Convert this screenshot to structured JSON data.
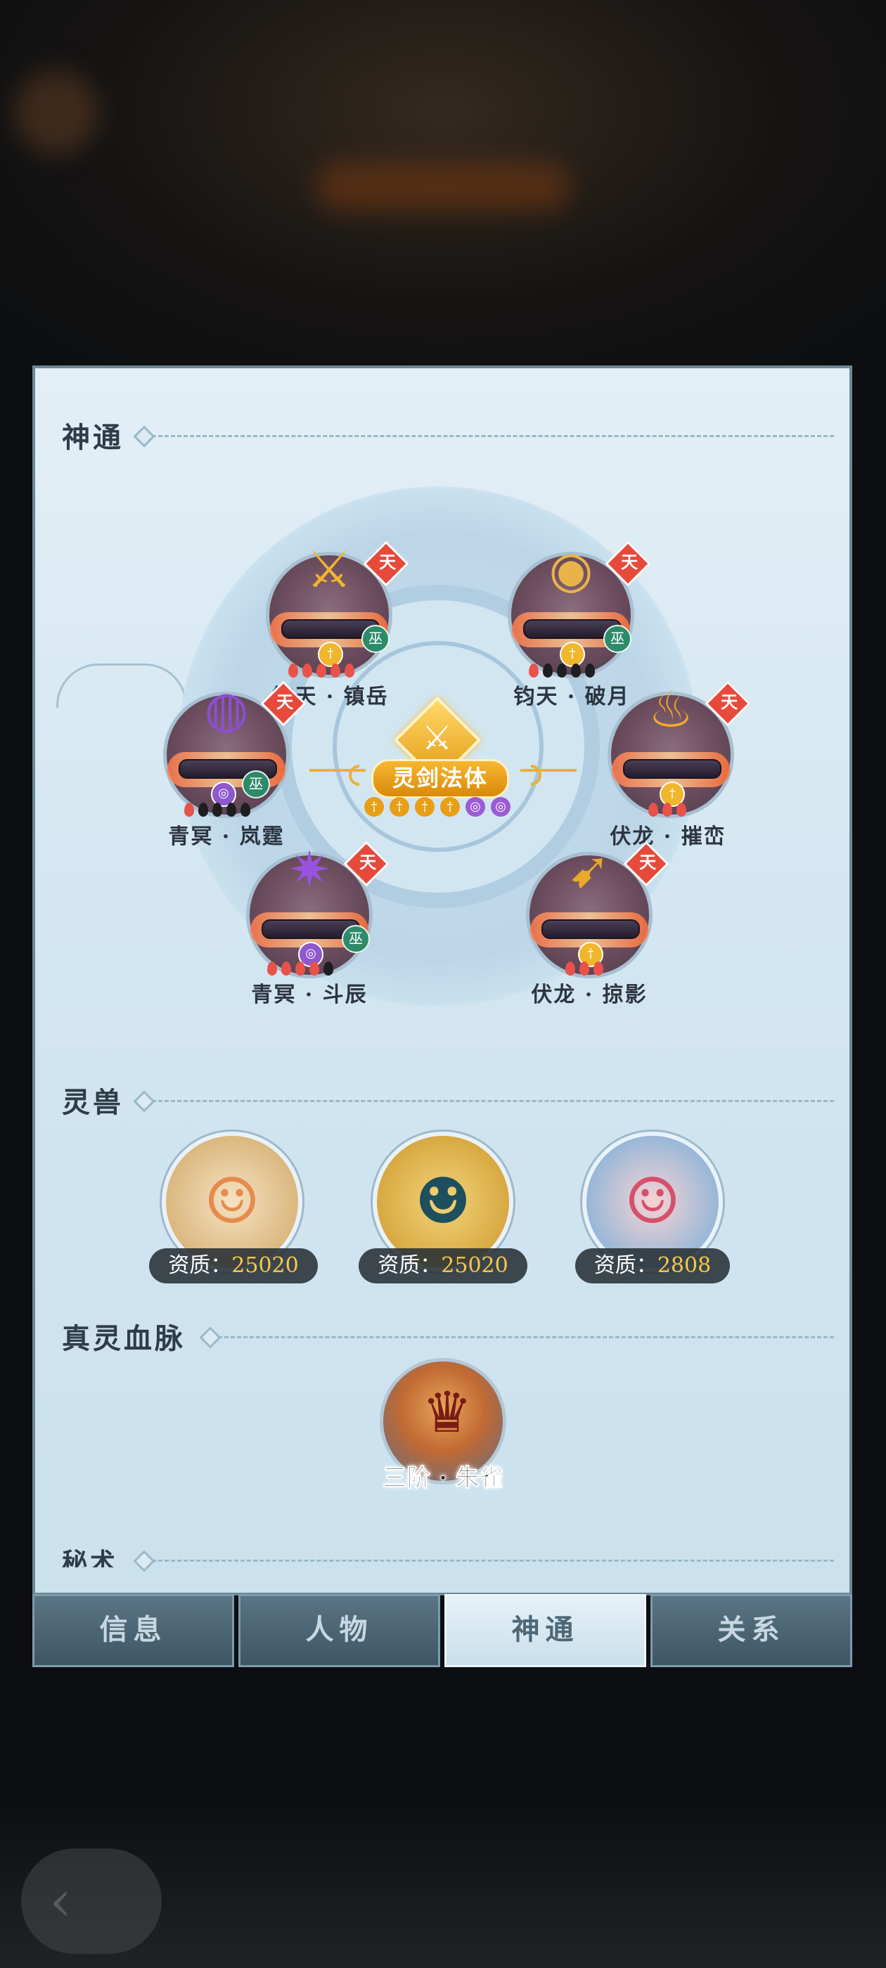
{
  "sections": {
    "shentong": "神通",
    "lingshou": "灵兽",
    "bloodline": "真灵血脉",
    "mishu": "秘术"
  },
  "center": {
    "title": "灵剑法体"
  },
  "skills": [
    {
      "name": "钧天 · 镇岳",
      "badge": "天",
      "sub_badge": "巫",
      "pips": [
        "red",
        "red",
        "red",
        "red",
        "red"
      ]
    },
    {
      "name": "钧天 · 破月",
      "badge": "天",
      "sub_badge": "巫",
      "pips": [
        "red",
        "black",
        "black",
        "black",
        "black"
      ]
    },
    {
      "name": "青冥 · 岚霆",
      "badge": "天",
      "sub_badge": "巫",
      "pips": [
        "red",
        "black",
        "black",
        "black",
        "black"
      ]
    },
    {
      "name": "伏龙 · 摧峦",
      "badge": "天",
      "sub_badge": "",
      "pips": [
        "red",
        "red",
        "red"
      ]
    },
    {
      "name": "青冥 · 斗辰",
      "badge": "天",
      "sub_badge": "巫",
      "pips": [
        "red",
        "red",
        "red",
        "red",
        "black"
      ]
    },
    {
      "name": "伏龙 · 掠影",
      "badge": "天",
      "sub_badge": "",
      "pips": [
        "red",
        "red",
        "red"
      ]
    }
  ],
  "beasts": [
    {
      "label": "资质：",
      "value": "25020"
    },
    {
      "label": "资质：",
      "value": "25020"
    },
    {
      "label": "资质：",
      "value": "2808"
    }
  ],
  "bloodline": {
    "label": "三阶 · 朱雀"
  },
  "tabs": [
    "信息",
    "人物",
    "神通",
    "关系"
  ],
  "active_tab": "神通",
  "colors": {
    "panel_bg": "#d3e6f1",
    "tab_active": "#e6f1f7",
    "tab_inactive": "#4a6473",
    "gold": "#e89f16",
    "aptitude_value": "#f5c84c"
  }
}
